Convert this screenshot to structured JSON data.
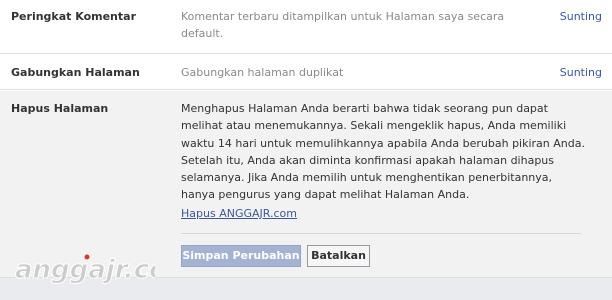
{
  "settings": {
    "rows": [
      {
        "label": "Peringkat Komentar",
        "value_lines": [
          "Komentar terbaru ditampilkan untuk Halaman saya secara",
          "default."
        ],
        "edit_label": "Sunting"
      },
      {
        "label": "Gabungkan Halaman",
        "value_lines": [
          "Gabungkan halaman duplikat"
        ],
        "edit_label": "Sunting"
      }
    ],
    "delete": {
      "label": "Hapus Halaman",
      "description_lines": [
        "Menghapus Halaman Anda berarti bahwa tidak seorang pun dapat",
        "melihat atau menemukannya. Sekali mengeklik hapus, Anda memiliki",
        "waktu 14 hari untuk memulihkannya apabila Anda berubah pikiran Anda.",
        "Setelah itu, Anda akan diminta konfirmasi apakah halaman dihapus",
        "selamanya. Jika Anda memilih untuk menghentikan penerbitannya,",
        "hanya pengurus yang dapat melihat Halaman Anda."
      ],
      "delete_link": "Hapus ANGGAJR.com",
      "save_button": "Simpan Perubahan",
      "cancel_button": "Batalkan"
    }
  },
  "watermark": {
    "text": "anggajr.com",
    "color": "#cccccc",
    "accent": "#d93b2b"
  },
  "colors": {
    "link": "#3b5998",
    "label": "#333333",
    "muted": "#8a8a8a",
    "section_bg": "#f2f2f2"
  }
}
